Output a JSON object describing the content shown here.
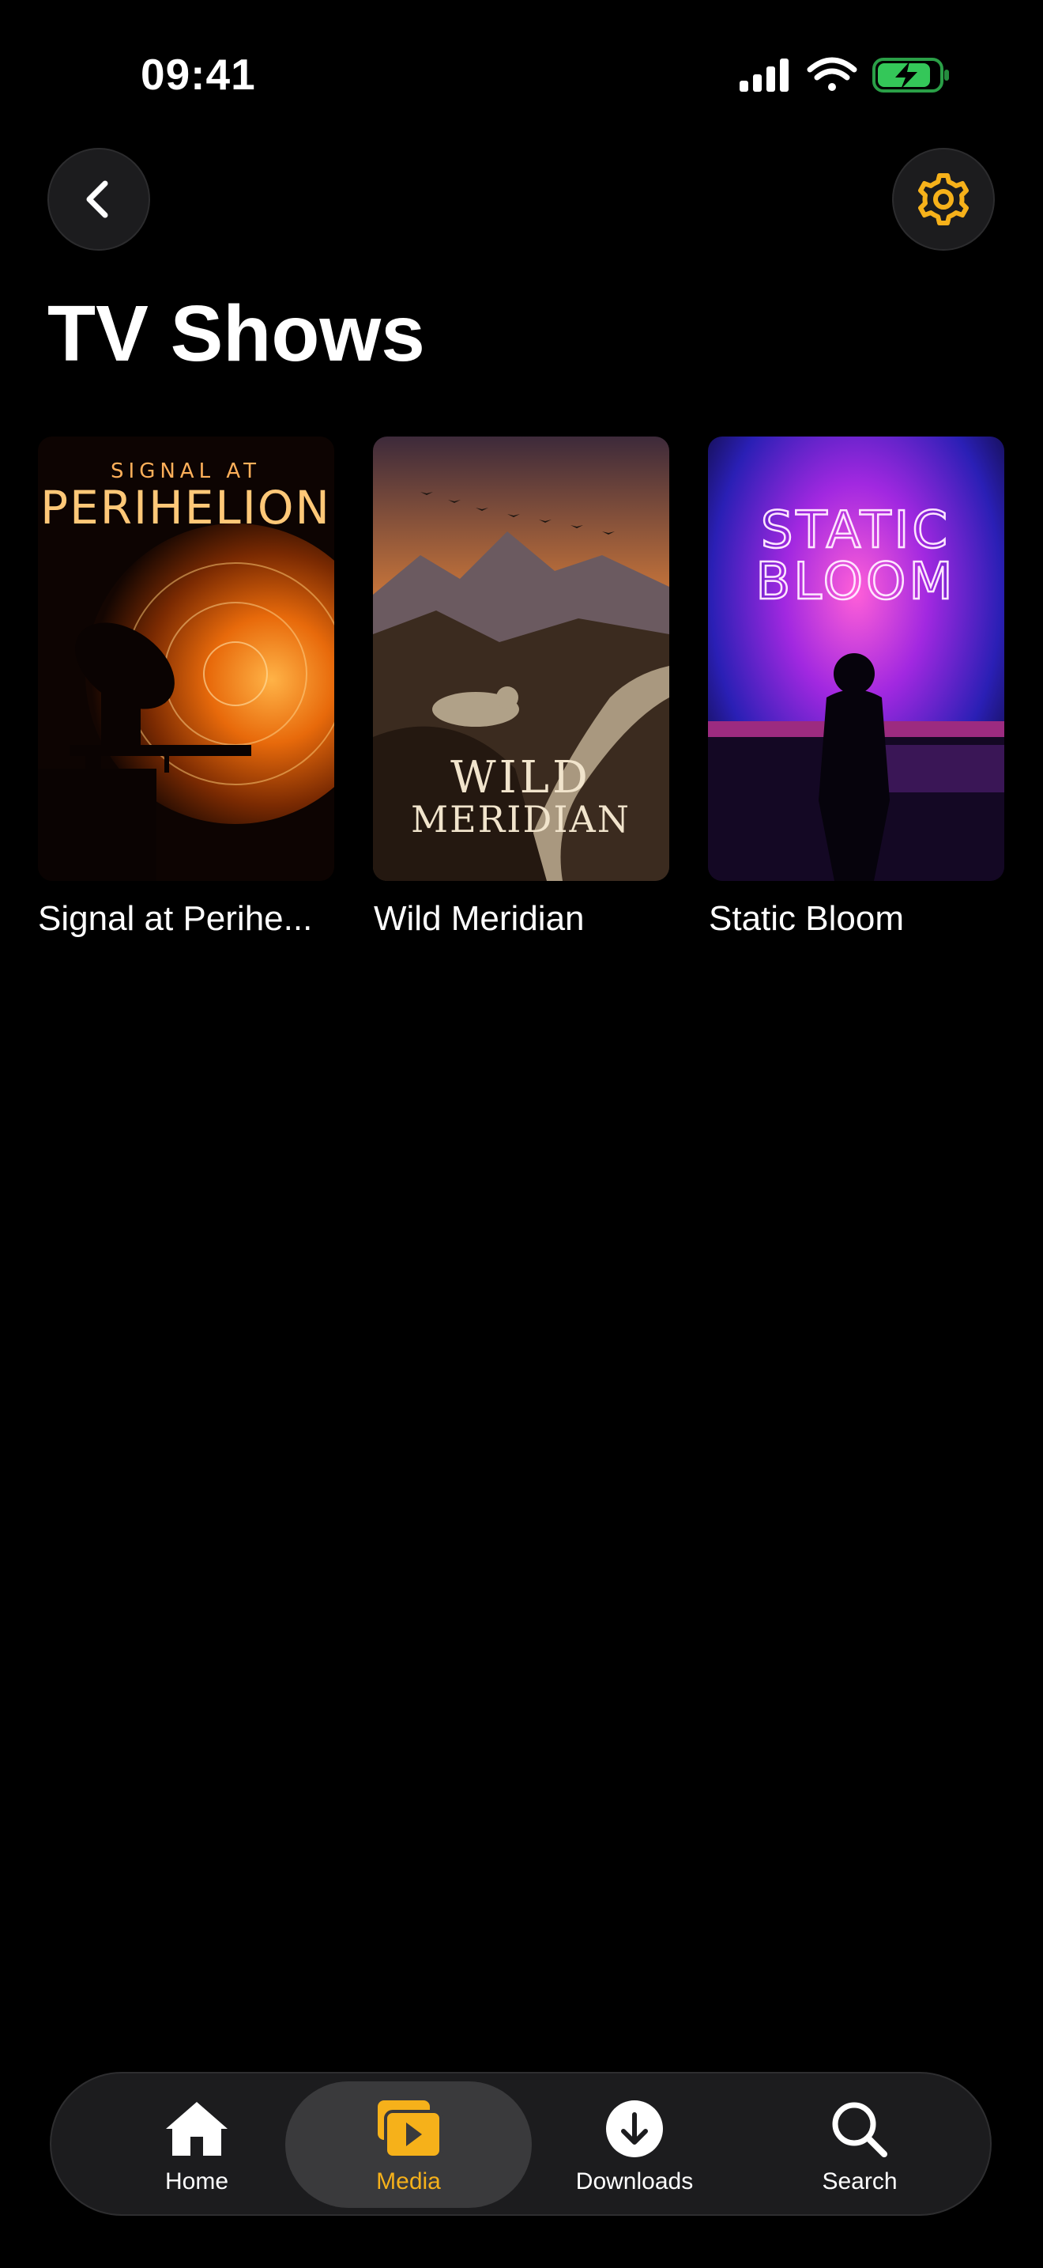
{
  "status_bar": {
    "time": "09:41",
    "icons": [
      "cellular-signal-icon",
      "wifi-icon",
      "battery-charging-icon"
    ]
  },
  "header": {
    "back_icon": "chevron-left-icon",
    "settings_icon": "gear-icon"
  },
  "page": {
    "title": "TV Shows"
  },
  "shows": [
    {
      "label": "Signal at Perihe...",
      "poster_title_top": "SIGNAL AT",
      "poster_title_bottom": "PERIHELION"
    },
    {
      "label": "Wild Meridian",
      "poster_title_top": "WILD",
      "poster_title_bottom": "MERIDIAN"
    },
    {
      "label": "Static Bloom",
      "poster_title_top": "STATIC",
      "poster_title_bottom": "BLOOM"
    }
  ],
  "tab_bar": {
    "tabs": [
      {
        "label": "Home",
        "icon": "house-icon",
        "selected": false
      },
      {
        "label": "Media",
        "icon": "media-play-icon",
        "selected": true
      },
      {
        "label": "Downloads",
        "icon": "download-icon",
        "selected": false
      },
      {
        "label": "Search",
        "icon": "search-icon",
        "selected": false
      }
    ]
  },
  "colors": {
    "background": "#000000",
    "accent": "#f6b11a",
    "surface": "#1c1c1e",
    "battery": "#34c759"
  }
}
